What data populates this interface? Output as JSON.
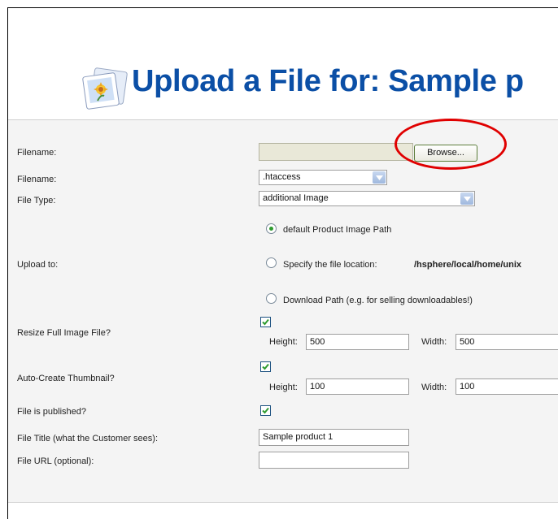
{
  "header": {
    "title": "Upload a File for: Sample p"
  },
  "form": {
    "filename_upload": {
      "label": "Filename:",
      "value": "",
      "browse_label": "Browse..."
    },
    "filename_select": {
      "label": "Filename:",
      "selected": ".htaccess"
    },
    "file_type": {
      "label": "File Type:",
      "selected": "additional Image"
    },
    "upload_to": {
      "label": "Upload to:",
      "options": [
        {
          "label": "default Product Image Path",
          "selected": true
        },
        {
          "label": "Specify the file location:",
          "path": "/hsphere/local/home/unix",
          "selected": false
        },
        {
          "label": "Download Path (e.g. for selling downloadables!)",
          "selected": false
        }
      ]
    },
    "resize_full": {
      "label": "Resize Full Image File?",
      "checked": true,
      "height_label": "Height:",
      "height": "500",
      "width_label": "Width:",
      "width": "500"
    },
    "auto_thumb": {
      "label": "Auto-Create Thumbnail?",
      "checked": true,
      "height_label": "Height:",
      "height": "100",
      "width_label": "Width:",
      "width": "100"
    },
    "published": {
      "label": "File is published?",
      "checked": true
    },
    "file_title": {
      "label": "File Title (what the Customer sees):",
      "value": "Sample product 1"
    },
    "file_url": {
      "label": "File URL (optional):",
      "value": ""
    }
  },
  "colors": {
    "title": "#0b4fa6",
    "highlight_circle": "#e00000",
    "check": "#2f9b2f"
  }
}
